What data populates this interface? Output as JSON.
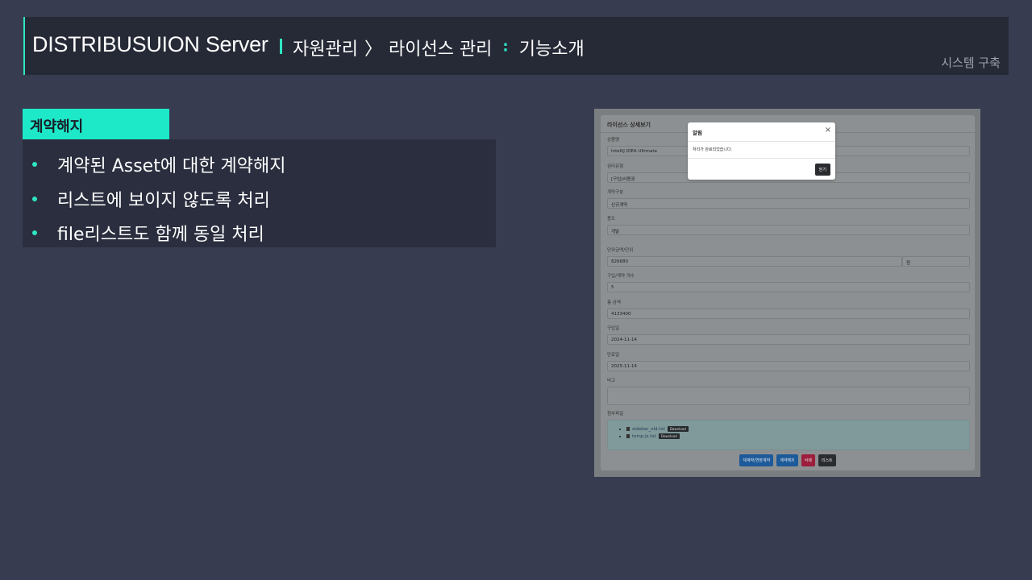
{
  "header": {
    "title": "DISTRIBUSUION Server",
    "crumb_1": "자원관리",
    "crumb_sep": "〉",
    "crumb_2": "라이선스 관리",
    "crumb_colon": "∶",
    "crumb_3": "기능소개",
    "subtitle": "시스템 구축"
  },
  "section": {
    "tag": "계약해지",
    "bullets": [
      "계약된 Asset에 대한 계약해지",
      "리스트에 보이지 않도록 처리",
      "file리스트도 함께 동일 처리"
    ]
  },
  "screenshot": {
    "title": "라이선스 상세보기",
    "fields": [
      {
        "label": "상품명",
        "value": "IntelliJ IDEA Ultimate"
      },
      {
        "label": "권리유형",
        "value": "[구입]사용권"
      },
      {
        "label": "계약구분",
        "value": "신규계약"
      },
      {
        "label": "용도",
        "value": "개발"
      },
      {
        "label": "단위금액/단위",
        "value": "826680",
        "unit": "원"
      },
      {
        "label": "구입/계약 개수",
        "value": "5"
      },
      {
        "label": "총 금액",
        "value": "4133400"
      },
      {
        "label": "구입일",
        "value": "2024-11-14"
      },
      {
        "label": "만료일",
        "value": "2025-11-14"
      },
      {
        "label": "비고",
        "value": ""
      }
    ],
    "attachments_label": "첨부파일",
    "attachments": [
      {
        "name": "sidebar_old.txt",
        "button": "Download"
      },
      {
        "name": "temp.js.txt",
        "button": "Download"
      }
    ],
    "actions": [
      "재계약/연장계약",
      "계약해지",
      "삭제",
      "리스트"
    ],
    "modal": {
      "title": "알림",
      "close": "×",
      "message": "처리가 완료되었습니다.",
      "button": "닫기"
    }
  },
  "colors": {
    "background": "#373c50",
    "header_bg": "#262a36",
    "accent": "#2ee6c3",
    "tag_bg": "#1de9c9"
  }
}
